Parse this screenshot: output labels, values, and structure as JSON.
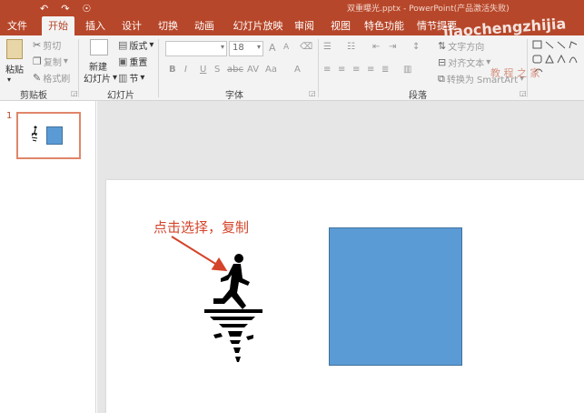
{
  "window": {
    "title": "双重曝光.pptx - PowerPoint(产品激活失败)",
    "qat": [
      "↶",
      "↷",
      "☉"
    ]
  },
  "tabs": [
    {
      "label": "文件"
    },
    {
      "label": "开始"
    },
    {
      "label": "插入"
    },
    {
      "label": "设计"
    },
    {
      "label": "切换"
    },
    {
      "label": "动画"
    },
    {
      "label": "幻灯片放映"
    },
    {
      "label": "审阅"
    },
    {
      "label": "视图"
    },
    {
      "label": "特色功能"
    },
    {
      "label": "情节提要"
    }
  ],
  "ribbon": {
    "clipboard": {
      "paste": "粘贴",
      "cut": "剪切",
      "copy": "复制",
      "format_painter": "格式刷",
      "label": "剪贴板"
    },
    "slides": {
      "new_slide_line1": "新建",
      "new_slide_line2": "幻灯片",
      "layout": "版式",
      "reset": "重置",
      "section": "节",
      "label": "幻灯片"
    },
    "font": {
      "font_name": "",
      "font_size": "18",
      "bold": "B",
      "italic": "I",
      "underline": "U",
      "strike": "S",
      "shadow": "abc",
      "spacing": "AV",
      "case": "Aa",
      "color": "A",
      "grow": "A",
      "shrink": "A",
      "label": "字体"
    },
    "paragraph": {
      "text_direction": "文字方向",
      "align_text": "对齐文本",
      "smartart": "转换为 SmartArt",
      "label": "段落"
    }
  },
  "watermark": {
    "main": "jiaochengzhijia",
    "sub": "教 程 之 家"
  },
  "thumbnails": [
    {
      "number": "1"
    }
  ],
  "slide": {
    "annotation": "点击选择，复制"
  },
  "colors": {
    "accent": "#b7472a",
    "rect_fill": "#5b9bd5",
    "annotation": "#d4442a"
  }
}
